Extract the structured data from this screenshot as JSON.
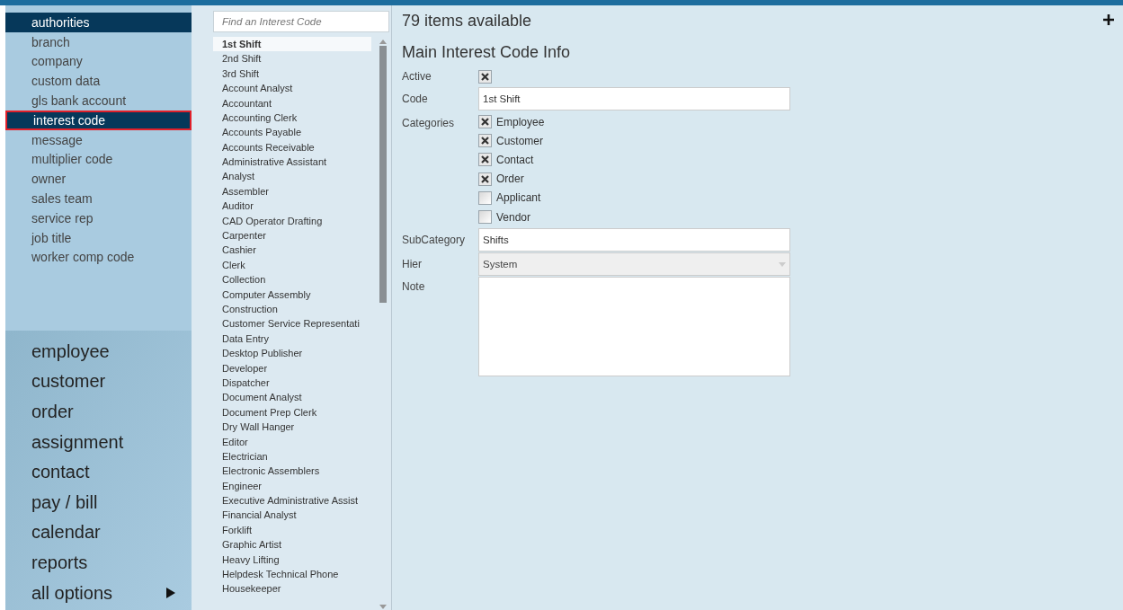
{
  "sidebar": {
    "items": [
      {
        "label": "authorities",
        "selected": true,
        "annotated": false
      },
      {
        "label": "branch",
        "selected": false,
        "annotated": false
      },
      {
        "label": "company",
        "selected": false,
        "annotated": false
      },
      {
        "label": "custom data",
        "selected": false,
        "annotated": false
      },
      {
        "label": "gls bank account",
        "selected": false,
        "annotated": false
      },
      {
        "label": "interest code",
        "selected": true,
        "annotated": true
      },
      {
        "label": "message",
        "selected": false,
        "annotated": false
      },
      {
        "label": "multiplier code",
        "selected": false,
        "annotated": false
      },
      {
        "label": "owner",
        "selected": false,
        "annotated": false
      },
      {
        "label": "sales team",
        "selected": false,
        "annotated": false
      },
      {
        "label": "service rep",
        "selected": false,
        "annotated": false
      },
      {
        "label": "job title",
        "selected": false,
        "annotated": false
      },
      {
        "label": "worker comp code",
        "selected": false,
        "annotated": false
      }
    ],
    "nav": [
      {
        "label": "employee",
        "submenu": false
      },
      {
        "label": "customer",
        "submenu": false
      },
      {
        "label": "order",
        "submenu": false
      },
      {
        "label": "assignment",
        "submenu": false
      },
      {
        "label": "contact",
        "submenu": false
      },
      {
        "label": "pay / bill",
        "submenu": false
      },
      {
        "label": "calendar",
        "submenu": false
      },
      {
        "label": "reports",
        "submenu": false
      },
      {
        "label": "all options",
        "submenu": true
      }
    ]
  },
  "list": {
    "search": {
      "placeholder": "Find an Interest Code"
    },
    "items": [
      {
        "label": "1st Shift",
        "selected": true
      },
      {
        "label": "2nd Shift",
        "selected": false
      },
      {
        "label": "3rd Shift",
        "selected": false
      },
      {
        "label": "Account Analyst",
        "selected": false
      },
      {
        "label": "Accountant",
        "selected": false
      },
      {
        "label": "Accounting Clerk",
        "selected": false
      },
      {
        "label": "Accounts Payable",
        "selected": false
      },
      {
        "label": "Accounts Receivable",
        "selected": false
      },
      {
        "label": "Administrative Assistant",
        "selected": false
      },
      {
        "label": "Analyst",
        "selected": false
      },
      {
        "label": "Assembler",
        "selected": false
      },
      {
        "label": "Auditor",
        "selected": false
      },
      {
        "label": "CAD Operator Drafting",
        "selected": false
      },
      {
        "label": "Carpenter",
        "selected": false
      },
      {
        "label": "Cashier",
        "selected": false
      },
      {
        "label": "Clerk",
        "selected": false
      },
      {
        "label": "Collection",
        "selected": false
      },
      {
        "label": "Computer Assembly",
        "selected": false
      },
      {
        "label": "Construction",
        "selected": false
      },
      {
        "label": "Customer Service Representati",
        "selected": false
      },
      {
        "label": "Data Entry",
        "selected": false
      },
      {
        "label": "Desktop Publisher",
        "selected": false
      },
      {
        "label": "Developer",
        "selected": false
      },
      {
        "label": "Dispatcher",
        "selected": false
      },
      {
        "label": "Document Analyst",
        "selected": false
      },
      {
        "label": "Document Prep Clerk",
        "selected": false
      },
      {
        "label": "Dry Wall Hanger",
        "selected": false
      },
      {
        "label": "Editor",
        "selected": false
      },
      {
        "label": "Electrician",
        "selected": false
      },
      {
        "label": "Electronic Assemblers",
        "selected": false
      },
      {
        "label": "Engineer",
        "selected": false
      },
      {
        "label": "Executive Administrative Assist",
        "selected": false
      },
      {
        "label": "Financial Analyst",
        "selected": false
      },
      {
        "label": "Forklift",
        "selected": false
      },
      {
        "label": "Graphic Artist",
        "selected": false
      },
      {
        "label": "Heavy Lifting",
        "selected": false
      },
      {
        "label": "Helpdesk Technical Phone",
        "selected": false
      },
      {
        "label": "Housekeeper",
        "selected": false
      }
    ]
  },
  "main": {
    "count": "79 items available",
    "heading": "Main Interest Code Info",
    "form": {
      "active": {
        "label": "Active",
        "checked": true
      },
      "code": {
        "label": "Code",
        "value": "1st Shift"
      },
      "categories": {
        "label": "Categories",
        "options": [
          {
            "label": "Employee",
            "checked": true
          },
          {
            "label": "Customer",
            "checked": true
          },
          {
            "label": "Contact",
            "checked": true
          },
          {
            "label": "Order",
            "checked": true
          },
          {
            "label": "Applicant",
            "checked": false
          },
          {
            "label": "Vendor",
            "checked": false
          }
        ]
      },
      "subcategory": {
        "label": "SubCategory",
        "value": "Shifts"
      },
      "hier": {
        "label": "Hier",
        "value": "System",
        "disabled": true
      },
      "note": {
        "label": "Note"
      }
    }
  }
}
